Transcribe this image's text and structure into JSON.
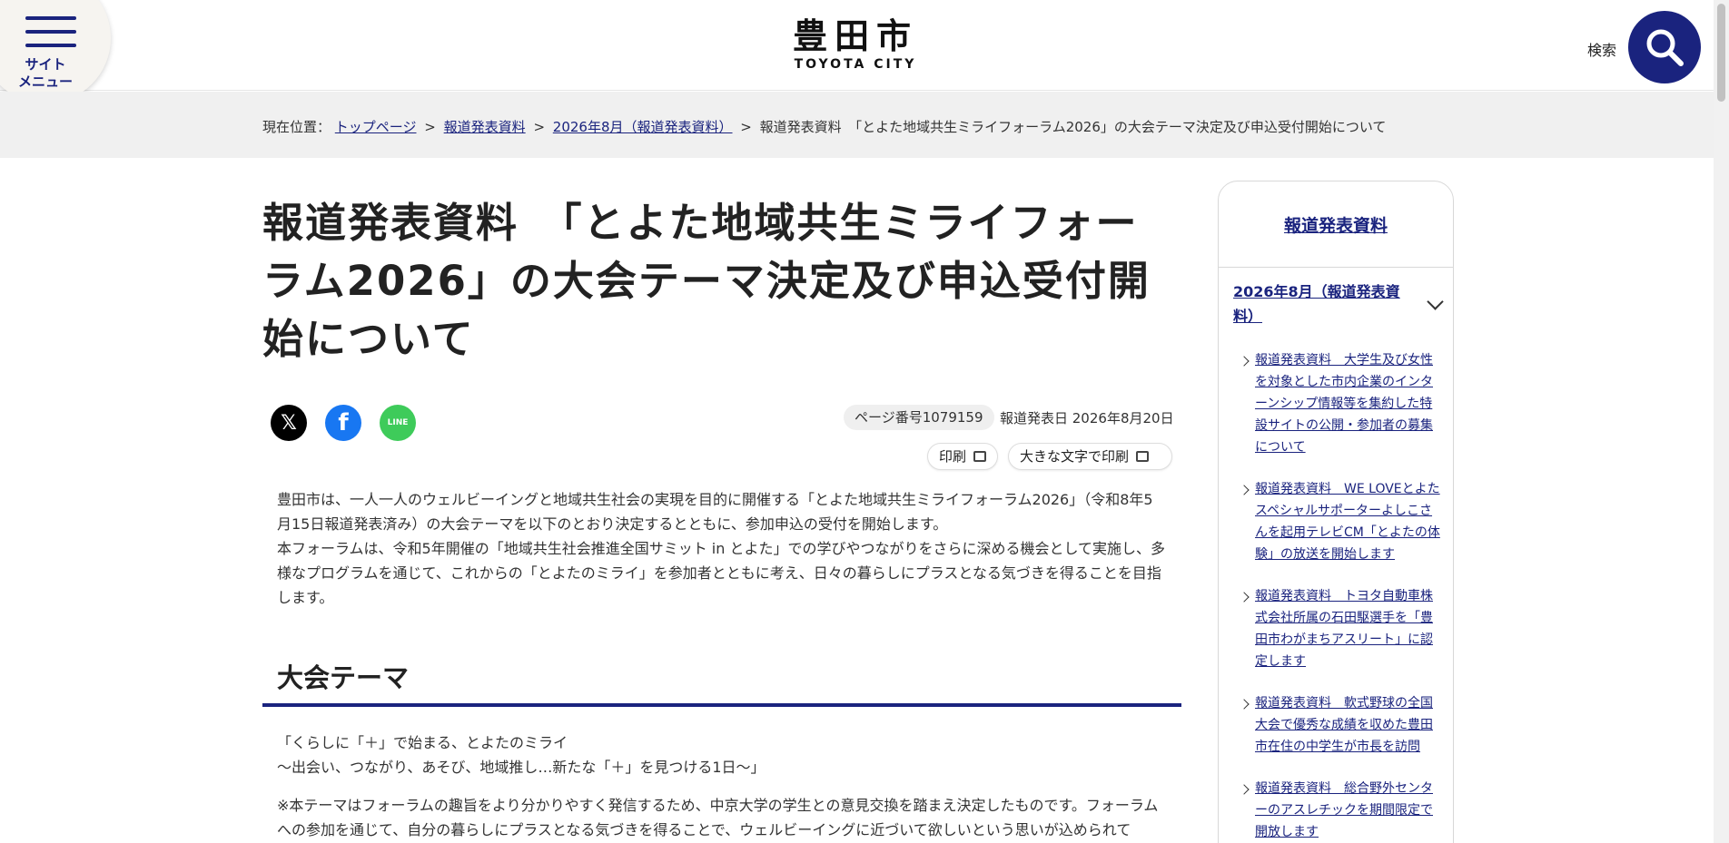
{
  "header": {
    "menu_label_1": "サイト",
    "menu_label_2": "メニュー",
    "logo_jp": "豊田市",
    "logo_en": "TOYOTA CITY",
    "search_label": "検索"
  },
  "breadcrumb": {
    "prefix": "現在位置：",
    "items": [
      "トップページ",
      "報道発表資料",
      "2026年8月（報道発表資料）"
    ],
    "current": "報道発表資料　「とよた地域共生ミライフォーラム2026」の大会テーマ決定及び申込受付開始について",
    "separator": ">"
  },
  "page": {
    "title": "報道発表資料　「とよた地域共生ミライフォーラム2026」の大会テーマ決定及び申込受付開始について",
    "page_number": "ページ番号1079159",
    "publish_date": "報道発表日 2026年8月20日",
    "print_label": "印刷",
    "print_large_label": "大きな文字で印刷",
    "share": {
      "x": "𝕏",
      "facebook": "f",
      "line": "LINE"
    },
    "intro_1": "豊田市は、一人一人のウェルビーイングと地域共生社会の実現を目的に開催する「とよた地域共生ミライフォーラム2026」（令和8年5月15日報道発表済み）の大会テーマを以下のとおり決定するとともに、参加申込の受付を開始します。",
    "intro_2": "本フォーラムは、令和5年開催の「地域共生社会推進全国サミット in とよた」での学びやつながりをさらに深める機会として実施し、多様なプログラムを通じて、これからの「とよたのミライ」を参加者とともに考え、日々の暮らしにプラスとなる気づきを得ることを目指します。",
    "section_heading": "大会テーマ",
    "theme_line_1": "「くらしに「＋」で始まる、とよたのミライ",
    "theme_line_2": "～出会い、つながり、あそび、地域推し…新たな「＋」を見つける1日～」",
    "note": "※本テーマはフォーラムの趣旨をより分かりやすく発信するため、中京大学の学生との意見交換を踏まえ決定したものです。フォーラムへの参加を通じて、自分の暮らしにプラスとなる気づきを得ることで、ウェルビーイングに近づいて欲しいという思いが込められて"
  },
  "sidebar": {
    "heading": "報道発表資料",
    "sub_heading": "2026年8月（報道発表資料）",
    "items": [
      "報道発表資料　大学生及び女性を対象とした市内企業のインターンシップ情報等を集約した特設サイトの公開・参加者の募集について",
      "報道発表資料　WE LOVEとよたスペシャルサポーターよしこさんを起用テレビCM「とよたの体験」の放送を開始します",
      "報道発表資料　トヨタ自動車株式会社所属の石田駆選手を「豊田市わがまちアスリート」に認定します",
      "報道発表資料　軟式野球の全国大会で優秀な成績を収めた豊田市在住の中学生が市長を訪問",
      "報道発表資料　総合野外センターのアスレチックを期間限定で開放します"
    ]
  },
  "colors": {
    "brand_navy": "#1a237e",
    "breadcrumb_bg": "#f0f0f0"
  }
}
